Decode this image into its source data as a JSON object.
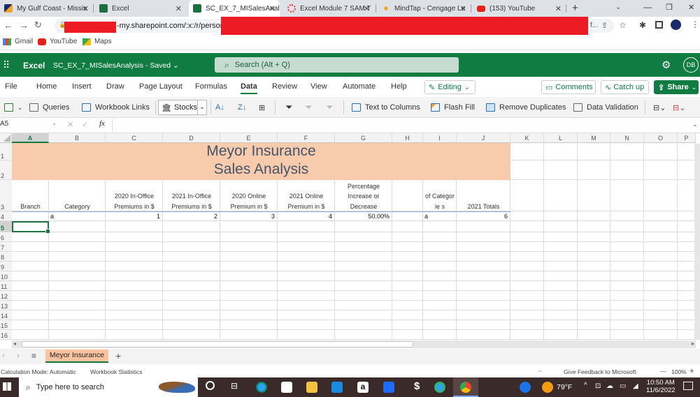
{
  "browser": {
    "tabs": [
      {
        "label": "My Gulf Coast - Missis",
        "icon": "gulf-coast-icon",
        "active": false
      },
      {
        "label": "Excel",
        "icon": "excel-icon",
        "active": false
      },
      {
        "label": "SC_EX_7_MISalesAnaly",
        "icon": "excel-icon",
        "active": true
      },
      {
        "label": "Excel Module 7 SAM T",
        "icon": "loading-icon",
        "active": false
      },
      {
        "label": "MindTap - Cengage Le",
        "icon": "mindtap-icon",
        "active": false
      },
      {
        "label": "(153) YouTube",
        "icon": "youtube-icon",
        "active": false
      }
    ],
    "new_tab": "+",
    "url": "-my.sharepoint.com/:x:/r/persona",
    "url_suffix": "f...",
    "bookmarks": [
      {
        "label": "Gmail",
        "icon": "gmail-icon"
      },
      {
        "label": "YouTube",
        "icon": "youtube-icon"
      },
      {
        "label": "Maps",
        "icon": "maps-icon"
      }
    ]
  },
  "excel": {
    "app_name": "Excel",
    "file_name": "SC_EX_7_MISalesAnalysis",
    "save_status": "- Saved",
    "search_placeholder": "Search (Alt + Q)",
    "user_initials": "DB",
    "ribbon_tabs": [
      "File",
      "Home",
      "Insert",
      "Draw",
      "Page Layout",
      "Formulas",
      "Data",
      "Review",
      "View",
      "Automate",
      "Help"
    ],
    "active_tab": "Data",
    "editing_label": "Editing",
    "comments_label": "Comments",
    "catchup_label": "Catch up",
    "share_label": "Share",
    "ribbon_commands": {
      "queries": "Queries",
      "workbook_links": "Workbook Links",
      "stocks": "Stocks",
      "text_to_columns": "Text to Columns",
      "flash_fill": "Flash Fill",
      "remove_duplicates": "Remove Duplicates",
      "data_validation": "Data Validation"
    },
    "name_box": "A5",
    "formula_value": "",
    "fx_label": "fx"
  },
  "sheet": {
    "columns": [
      "A",
      "B",
      "C",
      "D",
      "E",
      "F",
      "G",
      "H",
      "I",
      "J",
      "K",
      "L",
      "M",
      "N",
      "O",
      "P"
    ],
    "selected_column": "A",
    "rows": [
      "1",
      "2",
      "3",
      "4",
      "5",
      "6",
      "7",
      "8",
      "9",
      "10",
      "11",
      "12",
      "13",
      "14",
      "15",
      "16"
    ],
    "selected_row": "5",
    "title_line1": "Meyor Insurance",
    "title_line2": "Sales Analysis",
    "headers": {
      "A": "Branch",
      "B": "Category",
      "C": "2020 In-Office Premiums in $",
      "D": "2021 In-Office Premiums in $",
      "E": "2020 Online Premium in $",
      "F": "2021 Online Premium in $",
      "G": "Percentage Increase or Decrease",
      "H": "",
      "I": "of Categorie s",
      "J": "2021 Totals"
    },
    "row4": {
      "A": "",
      "B": "a",
      "C": "1",
      "D": "2",
      "E": "3",
      "F": "4",
      "G": "50.00%",
      "H": "",
      "I": "a",
      "J": "6"
    },
    "title_fill": "#f8cbad",
    "accent": "#107c41"
  },
  "sheet_tabs": {
    "active": "Meyor Insurance",
    "add": "+"
  },
  "status_bar": {
    "calc_mode": "Calculation Mode: Automatic",
    "workbook_stats": "Workbook Statistics",
    "feedback": "Give Feedback to Microsoft",
    "zoom": "100%",
    "zoom_minus": "—",
    "zoom_plus": "+"
  },
  "taskbar": {
    "search_placeholder": "Type here to search",
    "weather": "79°F",
    "time": "10:50 AM",
    "date": "11/6/2022"
  }
}
